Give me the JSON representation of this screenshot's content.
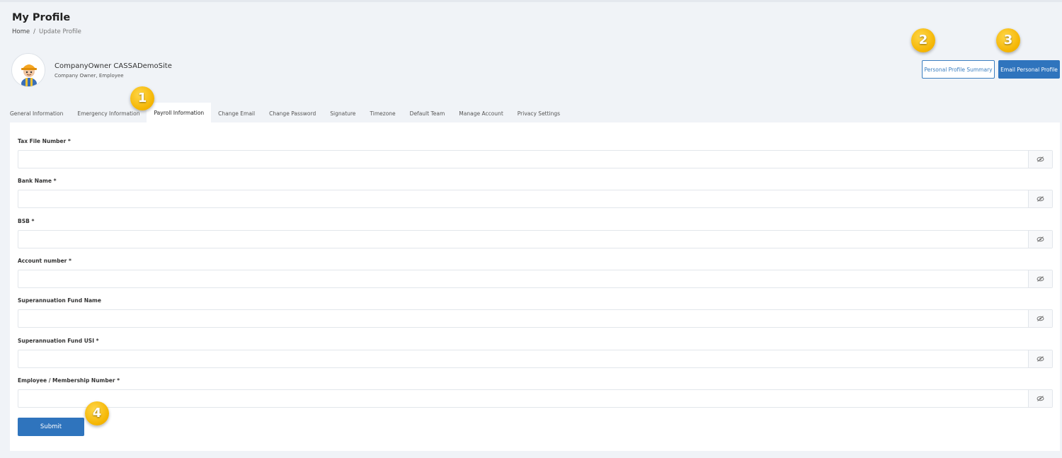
{
  "page": {
    "title": "My Profile",
    "breadcrumb": {
      "home": "Home",
      "separator": "/",
      "current": "Update Profile"
    }
  },
  "user": {
    "name": "CompanyOwner CASSADemoSite",
    "roles": "Company Owner, Employee",
    "avatar_icon": "worker-avatar-icon"
  },
  "actions": {
    "summary_label": "Personal Profile Summary",
    "email_label": "Email Personal Profile"
  },
  "tabs": [
    {
      "label": "General Information",
      "active": false
    },
    {
      "label": "Emergency Information",
      "active": false
    },
    {
      "label": "Payroll Information",
      "active": true
    },
    {
      "label": "Change Email",
      "active": false
    },
    {
      "label": "Change Password",
      "active": false
    },
    {
      "label": "Signature",
      "active": false
    },
    {
      "label": "Timezone",
      "active": false
    },
    {
      "label": "Default Team",
      "active": false
    },
    {
      "label": "Manage Account",
      "active": false
    },
    {
      "label": "Privacy Settings",
      "active": false
    }
  ],
  "form": {
    "fields": [
      {
        "label": "Tax File Number *",
        "value": ""
      },
      {
        "label": "Bank Name *",
        "value": ""
      },
      {
        "label": "BSB *",
        "value": ""
      },
      {
        "label": "Account number *",
        "value": ""
      },
      {
        "label": "Superannuation Fund Name",
        "value": ""
      },
      {
        "label": "Superannuation Fund USI *",
        "value": ""
      },
      {
        "label": "Employee / Membership Number *",
        "value": ""
      }
    ],
    "toggle_icon": "eye-slash-icon",
    "submit_label": "Submit"
  },
  "markers": [
    "1",
    "2",
    "3",
    "4"
  ],
  "colors": {
    "primary": "#2f74bd",
    "background": "#f0f3f7",
    "marker": "#f4b400"
  }
}
